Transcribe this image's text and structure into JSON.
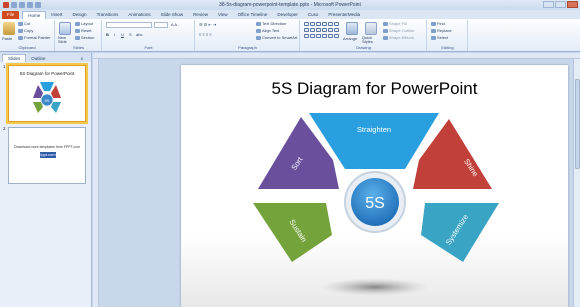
{
  "window": {
    "title": "38-5s-diagram-powerpoint-template.pptx - Microsoft PowerPoint"
  },
  "tabs": [
    "File",
    "Home",
    "Insert",
    "Design",
    "Transitions",
    "Animations",
    "Slide Show",
    "Review",
    "View",
    "Office Timeline",
    "Developer",
    "Cuso",
    "PresenterMedia"
  ],
  "ribbon": {
    "clipboard": {
      "paste": "Paste",
      "cut": "Cut",
      "copy": "Copy",
      "format_painter": "Format Painter",
      "label": "Clipboard"
    },
    "slides": {
      "new_slide": "New Slide",
      "layout": "Layout",
      "reset": "Reset",
      "section": "Section",
      "label": "Slides"
    },
    "font": {
      "label": "Font",
      "bold": "B",
      "italic": "I",
      "underline": "U",
      "strike": "S",
      "sub": "abc"
    },
    "paragraph": {
      "label": "Paragraph",
      "text_direction": "Text Direction",
      "align_text": "Align Text",
      "smartart": "Convert to SmartArt"
    },
    "drawing": {
      "label": "Drawing",
      "arrange": "Arrange",
      "quick_styles": "Quick Styles",
      "shape_fill": "Shape Fill",
      "shape_outline": "Shape Outline",
      "shape_effects": "Shape Effects"
    },
    "editing": {
      "label": "Editing",
      "find": "Find",
      "replace": "Replace",
      "select": "Select"
    }
  },
  "panes": {
    "slides_tab": "Slides",
    "outline_tab": "Outline",
    "close": "x"
  },
  "thumbnails": [
    {
      "number": "1",
      "title": "5S Diagram for PowerPoint",
      "center": "5S"
    },
    {
      "number": "2",
      "text": "Download more templates from FPPT.com",
      "link": "fppt.com"
    }
  ],
  "slide": {
    "title": "5S Diagram for PowerPoint",
    "center_label": "5S",
    "segments": [
      {
        "label": "Straighten",
        "color": "#2a9fe0"
      },
      {
        "label": "Shine",
        "color": "#c2403a"
      },
      {
        "label": "Systemize",
        "color": "#3aa4c4"
      },
      {
        "label": "Sustain",
        "color": "#74a33c"
      },
      {
        "label": "Sort",
        "color": "#6a4f9c"
      }
    ]
  }
}
